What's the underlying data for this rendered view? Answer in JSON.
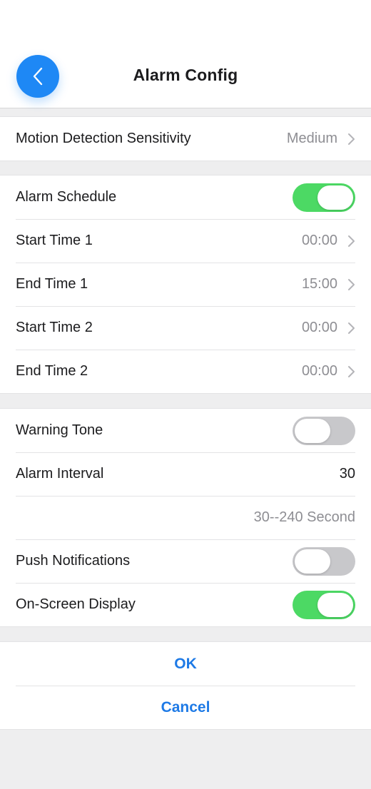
{
  "header": {
    "title": "Alarm Config",
    "back_icon": "chevron-left-icon",
    "accent_color": "#1e88f5"
  },
  "sensitivity": {
    "label": "Motion Detection Sensitivity",
    "value": "Medium"
  },
  "schedule": {
    "alarm_schedule_label": "Alarm Schedule",
    "alarm_schedule_on": true,
    "start_time_1_label": "Start Time 1",
    "start_time_1_value": "00:00",
    "end_time_1_label": "End Time 1",
    "end_time_1_value": "15:00",
    "start_time_2_label": "Start Time 2",
    "start_time_2_value": "00:00",
    "end_time_2_label": "End Time 2",
    "end_time_2_value": "00:00"
  },
  "options": {
    "warning_tone_label": "Warning Tone",
    "warning_tone_on": false,
    "alarm_interval_label": "Alarm Interval",
    "alarm_interval_value": "30",
    "interval_hint": "30--240 Second",
    "push_notifications_label": "Push Notifications",
    "push_notifications_on": false,
    "osd_label": "On-Screen Display",
    "osd_on": true
  },
  "actions": {
    "ok_label": "OK",
    "cancel_label": "Cancel"
  },
  "colors": {
    "toggle_on": "#4cd964",
    "toggle_off": "#c8c8cb",
    "action_text": "#1e7ae6"
  }
}
